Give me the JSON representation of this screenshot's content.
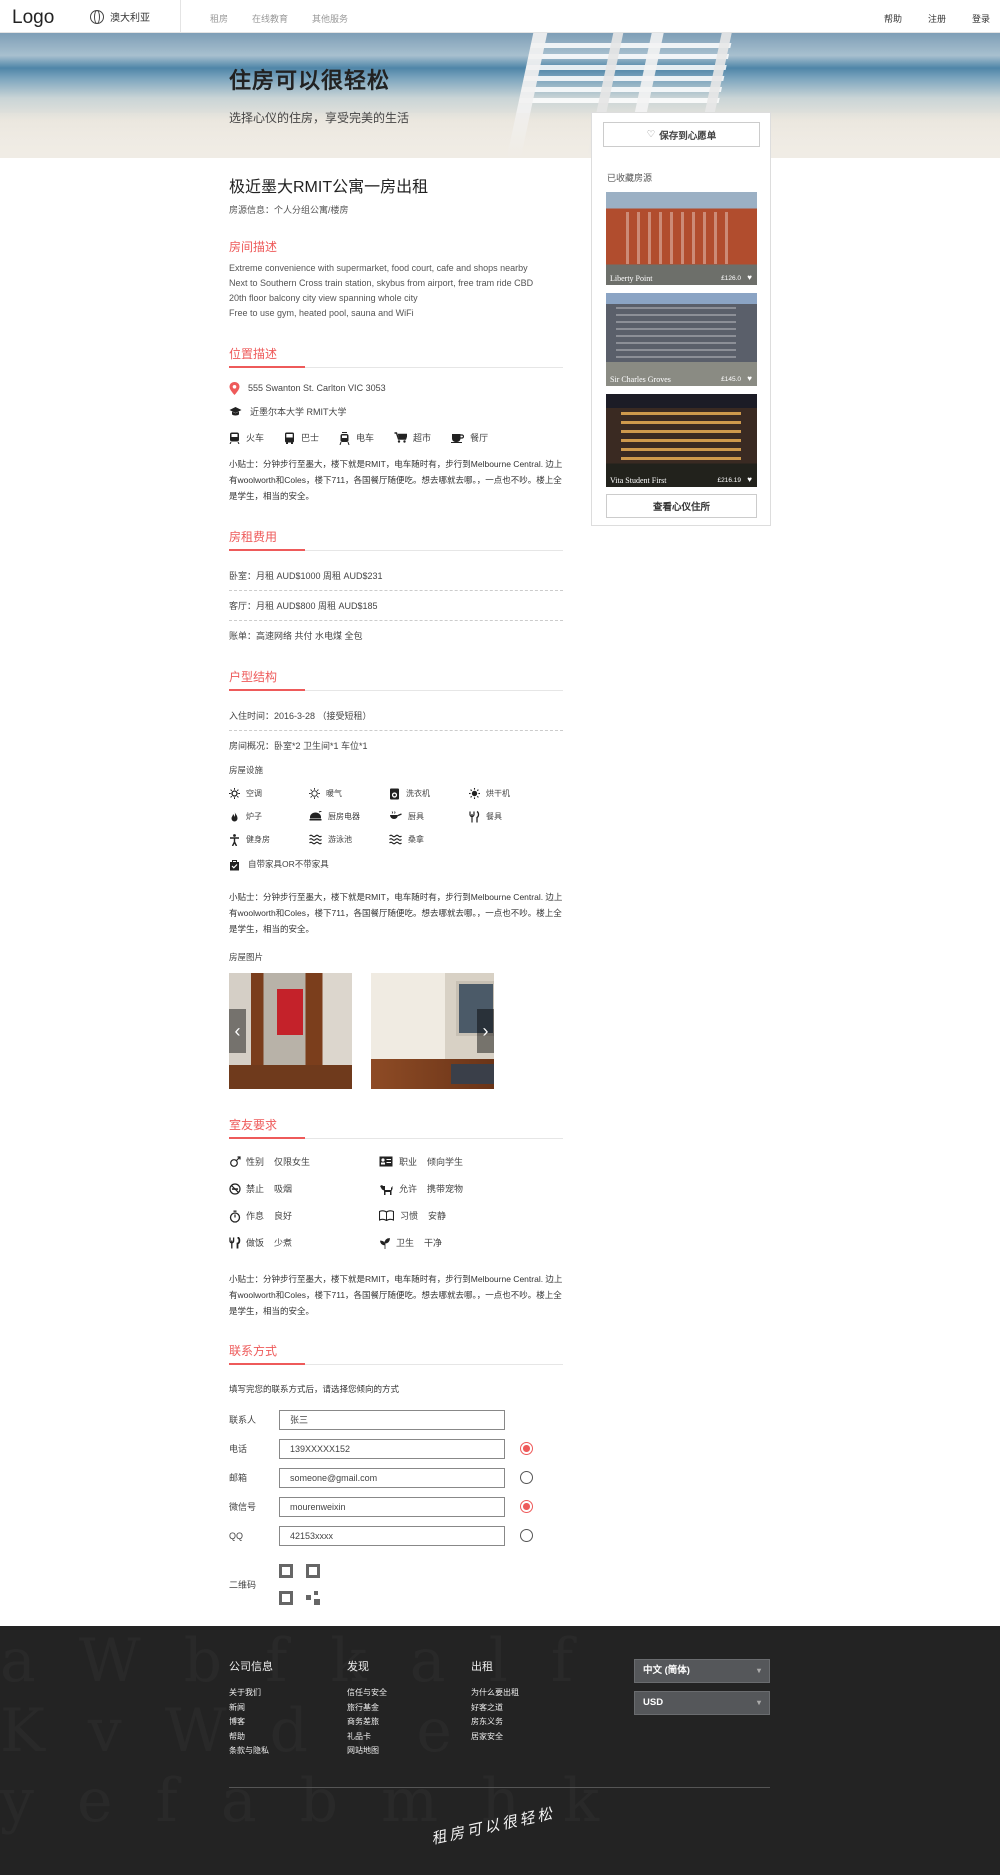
{
  "header": {
    "logo": "Logo",
    "region": "澳大利亚",
    "nav": [
      "租房",
      "在线教育",
      "其他服务"
    ],
    "user_nav": [
      "帮助",
      "注册",
      "登录"
    ]
  },
  "hero": {
    "title": "住房可以很轻松",
    "subtitle": "选择心仪的住房，享受完美的生活"
  },
  "listing": {
    "title": "极近墨大RMIT公寓一房出租",
    "subtitle": "房源信息：个人分组公寓/楼房"
  },
  "description": {
    "heading": "房间描述",
    "lines": [
      "Extreme convenience with supermarket, food court, cafe and shops nearby",
      "Next to Southern Cross train station, skybus from airport, free tram ride CBD",
      "20th floor balcony city view spanning whole city",
      "Free to use gym, heated pool, sauna and WiFi"
    ]
  },
  "location": {
    "heading": "位置描述",
    "address": "555 Swanton St. Carlton VIC 3053",
    "school": "近墨尔本大学 RMIT大学",
    "transport": [
      "火车",
      "巴士",
      "电车",
      "超市",
      "餐厅"
    ],
    "tips": "小贴士：分钟步行至墨大，楼下就是RMIT，电车随时有，步行到Melbourne Central. 边上有woolworth和Coles，楼下711，各国餐厅随便吃。想去哪就去哪。，一点也不吵。楼上全是学生，相当的安全。"
  },
  "fees": {
    "heading": "房租费用",
    "rows": [
      "卧室：月租  AUD$1000  周租  AUD$231",
      "客厅：月租  AUD$800  周租  AUD$185",
      "账单：高速网络  共付    水电煤  全包"
    ]
  },
  "layout": {
    "heading": "户型结构",
    "move_in": "入住时间：2016-3-28 （接受短租）",
    "overview": "房间概况：卧室*2  卫生间*1  车位*1",
    "facilities_label": "房屋设施",
    "amenities": [
      "空调",
      "暖气",
      "洗衣机",
      "烘干机",
      "炉子",
      "厨房电器",
      "厨具",
      "餐具",
      "健身房",
      "游泳池",
      "桑拿"
    ],
    "furniture": "自带家具OR不带家具",
    "tips": "小贴士：分钟步行至墨大，楼下就是RMIT，电车随时有，步行到Melbourne Central. 边上有woolworth和Coles，楼下711，各国餐厅随便吃。想去哪就去哪。，一点也不吵。楼上全是学生，相当的安全。",
    "photos_label": "房屋图片"
  },
  "roommate": {
    "heading": "室友要求",
    "items": [
      {
        "key": "性别",
        "value": "仅限女生"
      },
      {
        "key": "职业",
        "value": "倾向学生"
      },
      {
        "key": "禁止",
        "value": "吸烟"
      },
      {
        "key": "允许",
        "value": "携带宠物"
      },
      {
        "key": "作息",
        "value": "良好"
      },
      {
        "key": "习惯",
        "value": "安静"
      },
      {
        "key": "做饭",
        "value": "少煮"
      },
      {
        "key": "卫生",
        "value": "干净"
      }
    ],
    "tips": "小贴士：分钟步行至墨大，楼下就是RMIT，电车随时有，步行到Melbourne Central. 边上有woolworth和Coles，楼下711，各国餐厅随便吃。想去哪就去哪。，一点也不吵。楼上全是学生，相当的安全。"
  },
  "contact": {
    "heading": "联系方式",
    "intro": "填写完您的联系方式后，请选择您倾向的方式",
    "fields": [
      {
        "label": "联系人",
        "value": "张三"
      },
      {
        "label": "电话",
        "value": "139XXXXX152"
      },
      {
        "label": "邮箱",
        "value": "someone@gmail.com"
      },
      {
        "label": "微信号",
        "value": "mourenweixin"
      },
      {
        "label": "QQ",
        "value": "42153xxxx"
      }
    ],
    "qr_label": "二维码"
  },
  "sidebar": {
    "save_label": "保存到心愿单",
    "saved_label": "已收藏房源",
    "cards": [
      {
        "name": "Liberty Point",
        "price": "£126.0"
      },
      {
        "name": "Sir Charles Groves",
        "price": "£145.0"
      },
      {
        "name": "Vita Student First",
        "price": "£216.19"
      }
    ],
    "view_label": "查看心仪住所"
  },
  "footer": {
    "col1": {
      "heading": "公司信息",
      "links": [
        "关于我们",
        "新闻",
        "博客",
        "帮助",
        "条款与隐私"
      ]
    },
    "col2": {
      "heading": "发现",
      "links": [
        "信任与安全",
        "旅行基金",
        "商务差旅",
        "礼品卡",
        "网站地图"
      ]
    },
    "col3": {
      "heading": "出租",
      "links": [
        "为什么要出租",
        "好客之道",
        "房东义务",
        "居家安全"
      ]
    },
    "language": "中文 (简体)",
    "currency": "USD",
    "signature": "租房可以很轻松"
  },
  "colors": {
    "accent": "#ee5a5a",
    "footer_bg": "#232323"
  }
}
